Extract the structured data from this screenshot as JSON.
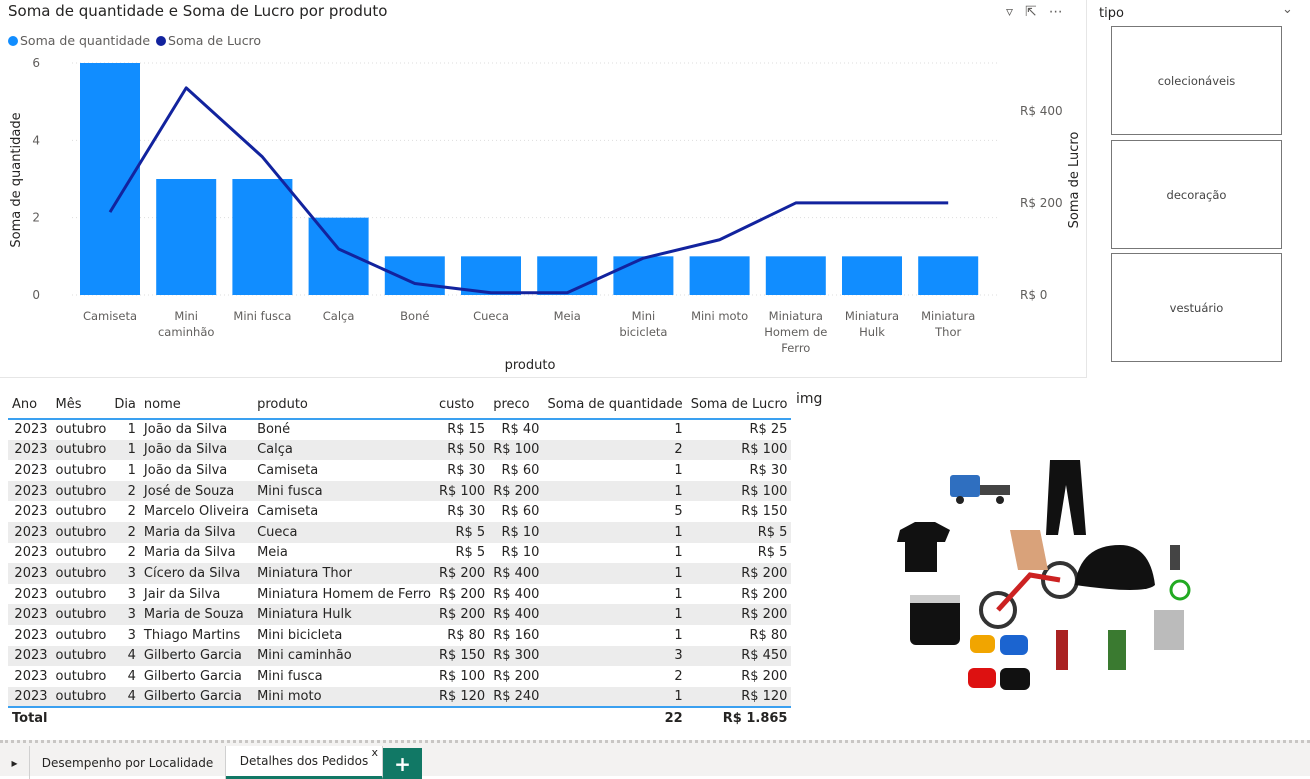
{
  "chart": {
    "title": "Soma de quantidade e Soma de Lucro por produto",
    "legend": [
      "Soma de quantidade",
      "Soma de Lucro"
    ],
    "icons": [
      "filter-icon",
      "focus-mode-icon",
      "more-options-icon"
    ]
  },
  "chart_data": {
    "type": "bar+line",
    "title": "Soma de quantidade e Soma de Lucro por produto",
    "xlabel": "produto",
    "ylabel": "Soma de quantidade",
    "y2label": "Soma de Lucro",
    "categories": [
      "Camiseta",
      "Mini caminhão",
      "Mini fusca",
      "Calça",
      "Boné",
      "Cueca",
      "Meia",
      "Mini bicicleta",
      "Mini moto",
      "Miniatura Homem de Ferro",
      "Miniatura Hulk",
      "Miniatura Thor"
    ],
    "series": [
      {
        "name": "Soma de quantidade",
        "type": "bar",
        "axis": "left",
        "color": "#118dff",
        "values": [
          6,
          3,
          3,
          2,
          1,
          1,
          1,
          1,
          1,
          1,
          1,
          1
        ]
      },
      {
        "name": "Soma de Lucro",
        "type": "line",
        "axis": "right",
        "color": "#12239e",
        "values": [
          180,
          450,
          300,
          100,
          25,
          5,
          5,
          80,
          120,
          200,
          200,
          200
        ]
      }
    ],
    "ylim": [
      0,
      6
    ],
    "yticks": [
      "0",
      "2",
      "4",
      "6"
    ],
    "y2lim": [
      0,
      504
    ],
    "y2ticks": [
      "R$ 0",
      "R$ 200",
      "R$ 400"
    ],
    "grid": true,
    "legend_position": "top-left"
  },
  "slicer": {
    "title": "tipo",
    "items": [
      "colecionáveis",
      "decoração",
      "vestuário"
    ]
  },
  "table": {
    "headers": [
      "Ano",
      "Mês",
      "Dia",
      "nome",
      "produto",
      "custo",
      "preco",
      "Soma de quantidade",
      "Soma de Lucro"
    ],
    "rows": [
      [
        "2023",
        "outubro",
        "1",
        "João da Silva",
        "Boné",
        "R$ 15",
        "R$ 40",
        "1",
        "R$ 25"
      ],
      [
        "2023",
        "outubro",
        "1",
        "João da Silva",
        "Calça",
        "R$ 50",
        "R$ 100",
        "2",
        "R$ 100"
      ],
      [
        "2023",
        "outubro",
        "1",
        "João da Silva",
        "Camiseta",
        "R$ 30",
        "R$ 60",
        "1",
        "R$ 30"
      ],
      [
        "2023",
        "outubro",
        "2",
        "José de Souza",
        "Mini fusca",
        "R$ 100",
        "R$ 200",
        "1",
        "R$ 100"
      ],
      [
        "2023",
        "outubro",
        "2",
        "Marcelo Oliveira",
        "Camiseta",
        "R$ 30",
        "R$ 60",
        "5",
        "R$ 150"
      ],
      [
        "2023",
        "outubro",
        "2",
        "Maria da Silva",
        "Cueca",
        "R$ 5",
        "R$ 10",
        "1",
        "R$ 5"
      ],
      [
        "2023",
        "outubro",
        "2",
        "Maria da Silva",
        "Meia",
        "R$ 5",
        "R$ 10",
        "1",
        "R$ 5"
      ],
      [
        "2023",
        "outubro",
        "3",
        "Cícero da Silva",
        "Miniatura Thor",
        "R$ 200",
        "R$ 400",
        "1",
        "R$ 200"
      ],
      [
        "2023",
        "outubro",
        "3",
        "Jair da Silva",
        "Miniatura Homem de Ferro",
        "R$ 200",
        "R$ 400",
        "1",
        "R$ 200"
      ],
      [
        "2023",
        "outubro",
        "3",
        "Maria de Souza",
        "Miniatura Hulk",
        "R$ 200",
        "R$ 400",
        "1",
        "R$ 200"
      ],
      [
        "2023",
        "outubro",
        "3",
        "Thiago Martins",
        "Mini bicicleta",
        "R$ 80",
        "R$ 160",
        "1",
        "R$ 80"
      ],
      [
        "2023",
        "outubro",
        "4",
        "Gilberto Garcia",
        "Mini caminhão",
        "R$ 150",
        "R$ 300",
        "3",
        "R$ 450"
      ],
      [
        "2023",
        "outubro",
        "4",
        "Gilberto Garcia",
        "Mini fusca",
        "R$ 100",
        "R$ 200",
        "2",
        "R$ 200"
      ],
      [
        "2023",
        "outubro",
        "4",
        "Gilberto Garcia",
        "Mini moto",
        "R$ 120",
        "R$ 240",
        "1",
        "R$ 120"
      ]
    ],
    "total": {
      "label": "Total",
      "quantidade": "22",
      "lucro": "R$ 1.865"
    }
  },
  "image_visual": {
    "title": "img"
  },
  "tabs": {
    "items": [
      "Desempenho por Localidade",
      "Detalhes dos Pedidos"
    ],
    "active": 1,
    "close": "x",
    "add": "+"
  }
}
